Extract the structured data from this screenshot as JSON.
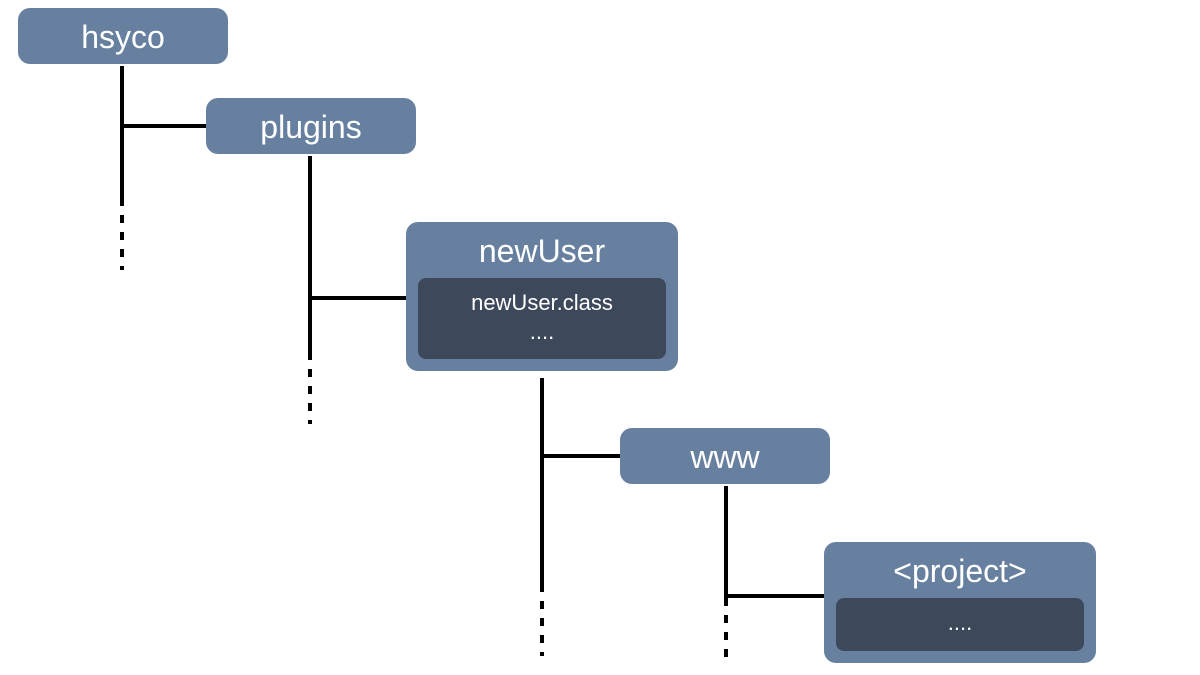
{
  "nodes": {
    "hsyco": {
      "label": "hsyco"
    },
    "plugins": {
      "label": "plugins"
    },
    "newUser": {
      "label": "newUser",
      "inner": {
        "line1": "newUser.class",
        "line2": "...."
      }
    },
    "www": {
      "label": "www"
    },
    "project": {
      "label": "<project>",
      "inner": {
        "line1": "...."
      }
    }
  },
  "colors": {
    "node_fill": "#6780a0",
    "inner_fill": "#3d495a",
    "line": "#000000",
    "text": "#ffffff"
  }
}
